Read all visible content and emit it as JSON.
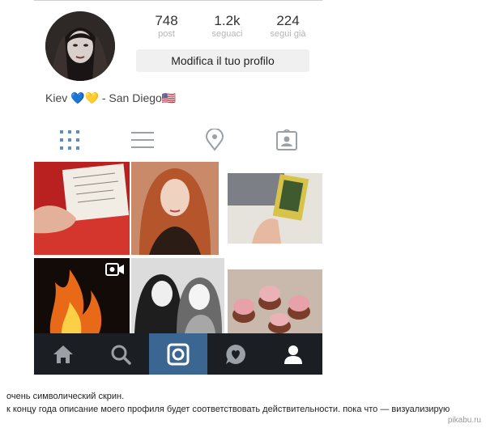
{
  "profile": {
    "stats": [
      {
        "value": "748",
        "label": "post"
      },
      {
        "value": "1.2k",
        "label": "seguaci"
      },
      {
        "value": "224",
        "label": "segui già"
      }
    ],
    "edit_button": "Modifica il tuo profilo",
    "bio": "Kiev 💙💛 - San Diego🇺🇸"
  },
  "tabs": [
    {
      "icon": "grid-icon",
      "active": true
    },
    {
      "icon": "list-icon",
      "active": false
    },
    {
      "icon": "location-pin-icon",
      "active": false
    },
    {
      "icon": "tagged-photos-icon",
      "active": false
    }
  ],
  "bottom_nav": [
    {
      "icon": "home-icon"
    },
    {
      "icon": "search-icon"
    },
    {
      "icon": "camera-icon",
      "active": true
    },
    {
      "icon": "heart-bubble-icon"
    },
    {
      "icon": "profile-icon"
    }
  ],
  "caption": {
    "line1": "очень символический скрин.",
    "line2": "к концу года описание моего профиля будет соответствовать действительности. пока что — визуализирую"
  },
  "watermark": "pikabu.ru",
  "colors": {
    "nav_bg": "#1b1f24",
    "nav_active": "#3b6691",
    "icon_inactive": "#9aa0a6"
  }
}
